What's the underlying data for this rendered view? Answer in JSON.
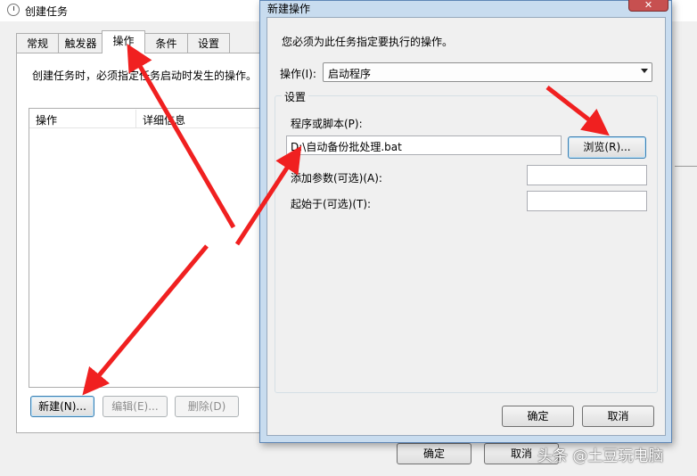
{
  "background_window": {
    "title": "创建任务",
    "tabs": [
      {
        "label": "常规",
        "active": false
      },
      {
        "label": "触发器",
        "active": false
      },
      {
        "label": "操作",
        "active": true
      },
      {
        "label": "条件",
        "active": false
      },
      {
        "label": "设置",
        "active": false
      }
    ],
    "description": "创建任务时，必须指定任务启动时发生的操作。",
    "list_columns": [
      "操作",
      "详细信息"
    ],
    "buttons": {
      "new": "新建(N)...",
      "edit": "编辑(E)...",
      "delete": "删除(D)",
      "ok": "确定",
      "cancel": "取消"
    }
  },
  "dialog": {
    "title": "新建操作",
    "close_glyph": "✕",
    "instruction": "您必须为此任务指定要执行的操作。",
    "action_label": "操作(I):",
    "action_value": "启动程序",
    "settings_group": "设置",
    "program_label": "程序或脚本(P):",
    "program_value": "D:\\自动备份批处理.bat",
    "browse_button": "浏览(R)...",
    "args_label": "添加参数(可选)(A):",
    "args_value": "",
    "start_in_label": "起始于(可选)(T):",
    "start_in_value": "",
    "ok_button": "确定",
    "cancel_button": "取消"
  },
  "watermark": "头条 @土豆玩电脑",
  "colors": {
    "annotation_arrow": "#f02020",
    "dialog_frame": "#c8dcef",
    "window_bg": "#f0f0f0"
  },
  "icons": {
    "window_icon": "task-scheduler-clock-icon",
    "dropdown": "dropdown-arrow-icon",
    "close": "close-icon"
  }
}
